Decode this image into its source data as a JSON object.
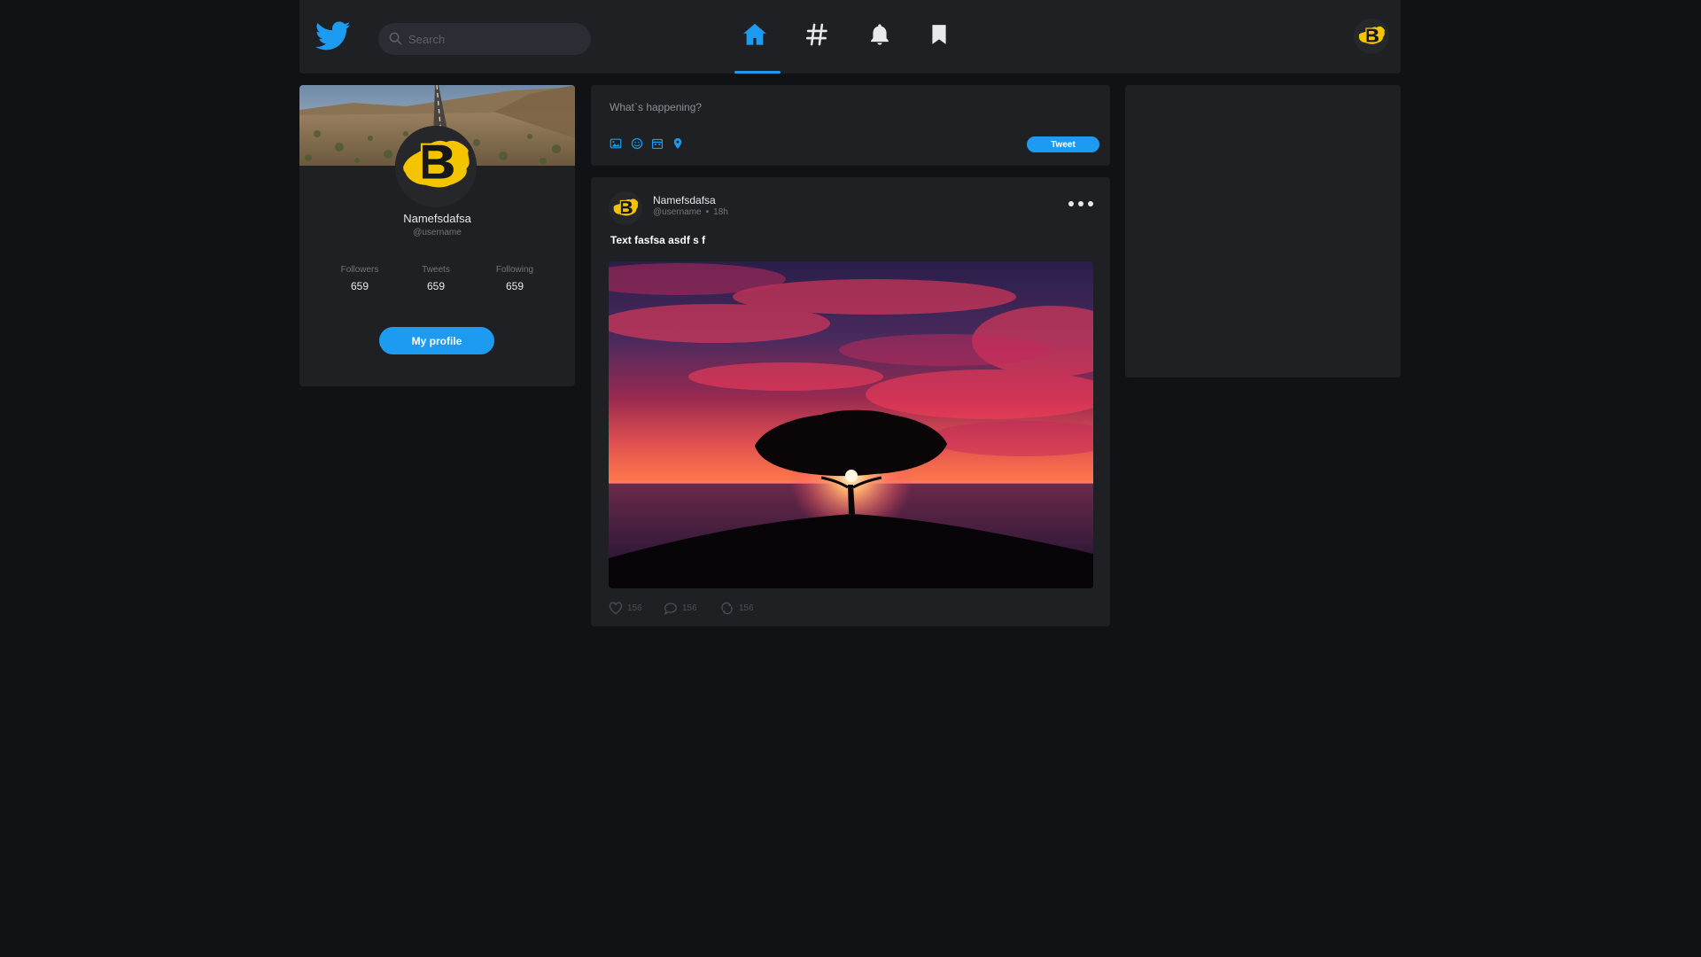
{
  "header": {
    "logo_icon": "twitter-bird-icon",
    "search": {
      "placeholder": "Search",
      "value": ""
    },
    "nav": [
      {
        "icon": "home-icon",
        "active": true
      },
      {
        "icon": "hashtag-icon",
        "active": false
      },
      {
        "icon": "bell-icon",
        "active": false
      },
      {
        "icon": "bookmark-icon",
        "active": false
      }
    ],
    "avatar_icon": "user-avatar-icon"
  },
  "profile": {
    "name": "Namefsdafsa",
    "handle": "@username",
    "stats": {
      "followers_label": "Followers",
      "followers_value": "659",
      "tweets_label": "Tweets",
      "tweets_value": "659",
      "following_label": "Following",
      "following_value": "659"
    },
    "button_label": "My profile"
  },
  "compose": {
    "placeholder": "What`s happening?",
    "tools": [
      "image-icon",
      "emoji-icon",
      "schedule-icon",
      "location-icon"
    ],
    "tweet_label": "Tweet"
  },
  "post": {
    "author_name": "Namefsdafsa",
    "author_handle": "@username",
    "separator": "•",
    "time": "18h",
    "text": "Text fasfsa asdf s f",
    "likes": "156",
    "replies": "156",
    "retweets": "156"
  },
  "colors": {
    "background": "#111215",
    "panel": "#1e2024",
    "accent": "#1d9bf0",
    "brand_yellow": "#f5c400"
  }
}
